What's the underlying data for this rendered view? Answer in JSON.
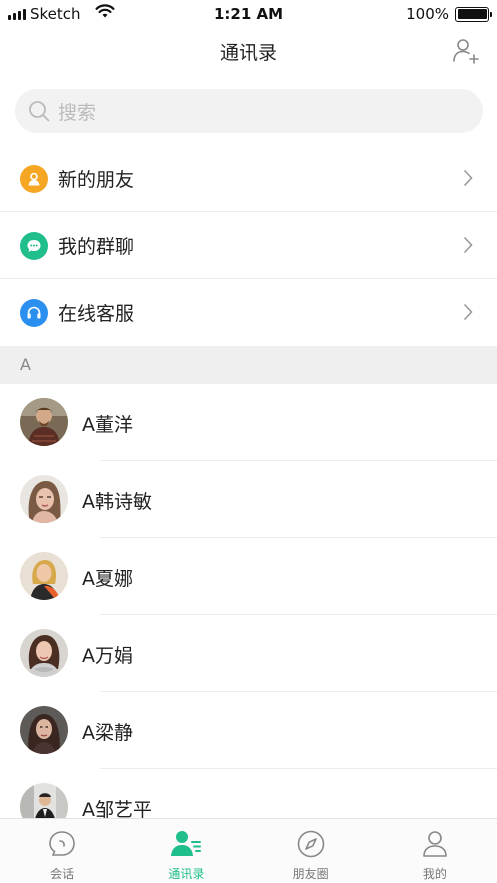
{
  "status_bar": {
    "carrier": "Sketch",
    "time": "1:21 AM",
    "battery": "100%"
  },
  "nav": {
    "title": "通讯录"
  },
  "search": {
    "placeholder": "搜索"
  },
  "features": [
    {
      "label": "新的朋友",
      "icon": "new-friend-icon",
      "color": "#f5a623"
    },
    {
      "label": "我的群聊",
      "icon": "group-chat-icon",
      "color": "#1fbe8c"
    },
    {
      "label": "在线客服",
      "icon": "headset-icon",
      "color": "#2b8ff0"
    }
  ],
  "section": {
    "letter": "A"
  },
  "contacts": [
    {
      "name": "A董洋"
    },
    {
      "name": "A韩诗敏"
    },
    {
      "name": "A夏娜"
    },
    {
      "name": "A万娟"
    },
    {
      "name": "A梁静"
    },
    {
      "name": "A邹艺平"
    }
  ],
  "tabs": [
    {
      "label": "会话",
      "icon": "chat-bubble-icon",
      "active": false
    },
    {
      "label": "通讯录",
      "icon": "contacts-icon",
      "active": true
    },
    {
      "label": "朋友圈",
      "icon": "compass-icon",
      "active": false
    },
    {
      "label": "我的",
      "icon": "profile-icon",
      "active": false
    }
  ],
  "colors": {
    "accent": "#1fbe8c",
    "section_bg": "#efefef",
    "search_bg": "#f2f2f2"
  }
}
